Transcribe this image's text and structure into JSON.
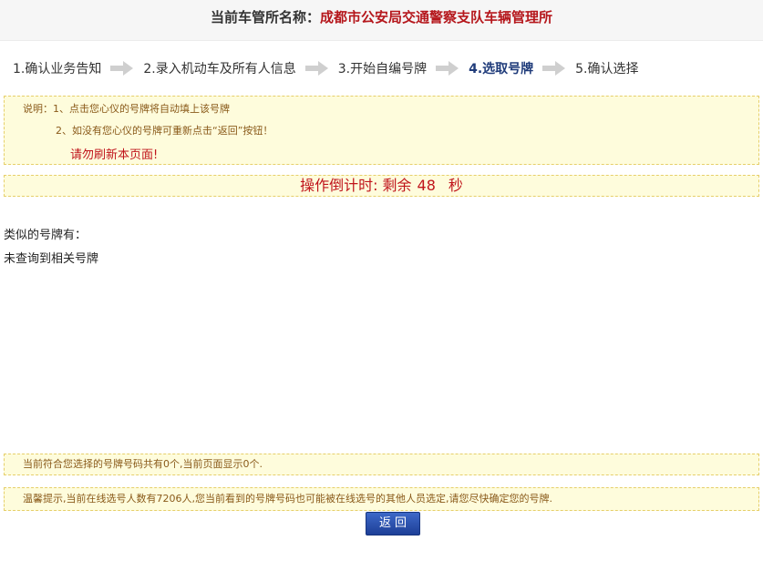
{
  "header": {
    "label": "当前车管所名称：",
    "office": "成都市公安局交通警察支队车辆管理所"
  },
  "steps": [
    {
      "label": "1.确认业务告知",
      "active": false
    },
    {
      "label": "2.录入机动车及所有人信息",
      "active": false
    },
    {
      "label": "3.开始自编号牌",
      "active": false
    },
    {
      "label": "4.选取号牌",
      "active": true
    },
    {
      "label": "5.确认选择",
      "active": false
    }
  ],
  "instructions": {
    "line1": "说明：1、点击您心仪的号牌将自动填上该号牌",
    "line2": "2、如没有您心仪的号牌可重新点击“返回”按钮！",
    "line3": "请勿刷新本页面!"
  },
  "countdown": {
    "prefix": "操作倒计时: 剩余",
    "seconds": "48",
    "suffix": "秒"
  },
  "results": {
    "label": "类似的号牌有：",
    "empty_message": "未查询到相关号牌"
  },
  "summary": "当前符合您选择的号牌号码共有0个,当前页面显示0个.",
  "tip": "温馨提示,当前在线选号人数有7206人,您当前看到的号牌号码也可能被在线选号的其他人员选定,请您尽快确定您的号牌.",
  "buttons": {
    "back": "返回"
  },
  "colors": {
    "accent_red": "#c0141b",
    "step_active": "#1f3b7a",
    "notice_bg": "#fefcdc",
    "button_blue": "#1d3f97"
  }
}
